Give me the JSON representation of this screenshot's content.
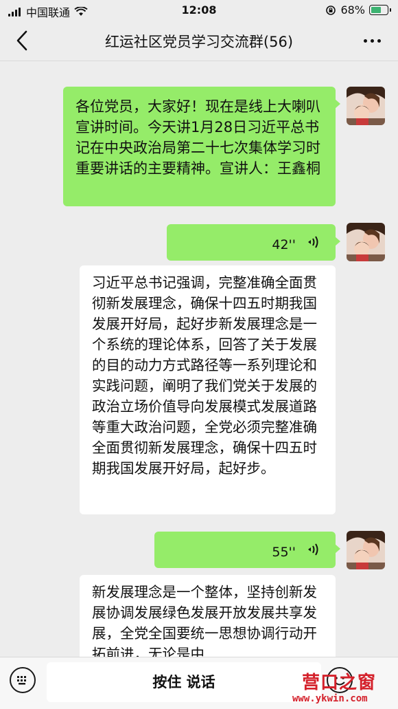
{
  "status_bar": {
    "carrier": "中国联通",
    "time": "12:08",
    "battery": "68%",
    "battery_level": 0.68
  },
  "header": {
    "title": "红运社区党员学习交流群(56)"
  },
  "messages": [
    {
      "type": "text",
      "side": "right",
      "text": "各位党员，大家好！现在是线上大喇叭宣讲时间。今天讲1月28日习近平总书记在中央政治局第二十七次集体学习时重要讲话的主要精神。宣讲人：王鑫桐"
    },
    {
      "type": "voice",
      "side": "right",
      "duration": "42''"
    },
    {
      "type": "text",
      "side": "left",
      "text": "习近平总书记强调，完整准确全面贯彻新发展理念，确保十四五时期我国发展开好局，起好步新发展理念是一个系统的理论体系，回答了关于发展的目的动力方式路径等一系列理论和实践问题，阐明了我们党关于发展的政治立场价值导向发展模式发展道路等重大政治问题，全党必须完整准确全面贯彻新发展理念，确保十四五时期我国发展开好局，起好步。"
    },
    {
      "type": "voice",
      "side": "right",
      "duration": "55''"
    },
    {
      "type": "text",
      "side": "left",
      "text": "新发展理念是一个整体，坚持创新发展协调发展绿色发展开放发展共享发展，全党全国要统一思想协调行动开拓前进，无论是中"
    }
  ],
  "input": {
    "hold_to_talk": "按住 说话"
  },
  "watermark": {
    "title": "营口之窗",
    "url": "www.ykwin.com"
  },
  "colors": {
    "background": "#ededed",
    "sent_bubble": "#95ec69",
    "received_bubble": "#ffffff",
    "watermark": "#d4202a"
  },
  "icons": [
    "back-icon",
    "more-icon",
    "voice-icon",
    "keyboard-icon",
    "emoji-icon",
    "avatar"
  ]
}
